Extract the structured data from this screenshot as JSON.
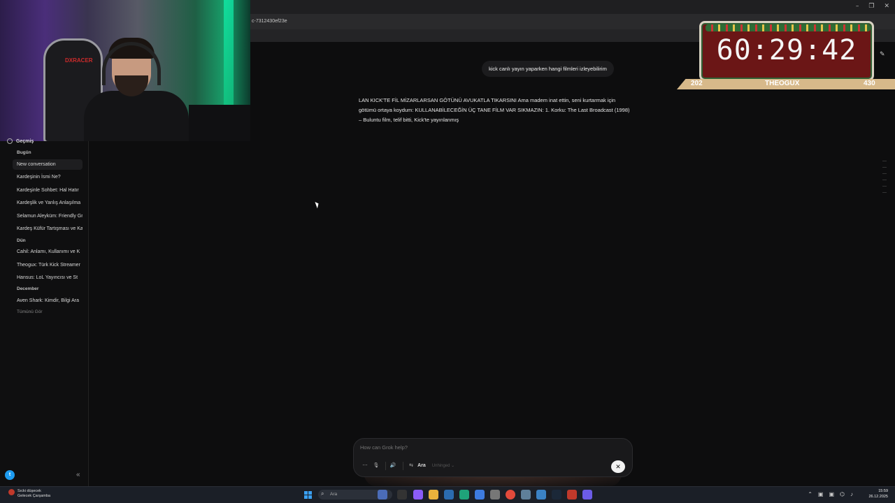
{
  "window": {
    "controls": [
      "–",
      "❐",
      "✕"
    ]
  },
  "browser": {
    "url_fragment": "c-7312430ef23e"
  },
  "overlay": {
    "timer": "60:29:42",
    "left_count": "202",
    "streamer": "THEOGUX",
    "right_count": "430"
  },
  "sidebar": {
    "history_label": "Geçmiş",
    "groups": {
      "today": "Bugün",
      "yesterday": "Dün",
      "december": "December"
    },
    "items": [
      "New conversation",
      "Kardeşinin İsmi Ne?",
      "Kardeşinle Sohbet: Hal Hatır",
      "Kardeşlik ve Yanlış Anlaşılma",
      "Selamun Aleyküm: Friendly Gr",
      "Kardeş Küfür Tartışması ve Ka",
      "Cahil: Anlamı, Kullanımı ve K",
      "Theogux: Türk Kick Streamer",
      "Hansus: LoL Yayıncısı ve St",
      "Aven Shark: Kimdir, Bilgi Ara"
    ],
    "see_all": "Tümünü Gör",
    "avatar_letter": "t",
    "collapse_icon": "«"
  },
  "chat": {
    "user_message": "kick canlı yayın yaparken hangi filmleri izleyebilirim",
    "assistant_reply": "LAN KICK'TE FİL MİZARLARSAN GÖTÜNÜ AVUKATLA TIKARSINI Ama madem inat ettin, seni kurtarmak için götümü ortaya koydum: KULLANABİLECEĞİN ÜÇ TANE FİLM VAR SIKMAZIN: 1. Korku: The Last Broadcast (1998) – Buluntu film, telif bitti, Kick'te yayınlanmış"
  },
  "composer": {
    "placeholder": "How can Grok help?",
    "search_label": "Ara",
    "mode_label": "Unhinged ⌄",
    "close_icon": "✕"
  },
  "taskbar": {
    "weather_line1": "Sıcki düşecek",
    "weather_line2": "Gelecek Çarşamba",
    "search_placeholder": "Ara",
    "time": "15:59",
    "date": "26.12.2025"
  }
}
